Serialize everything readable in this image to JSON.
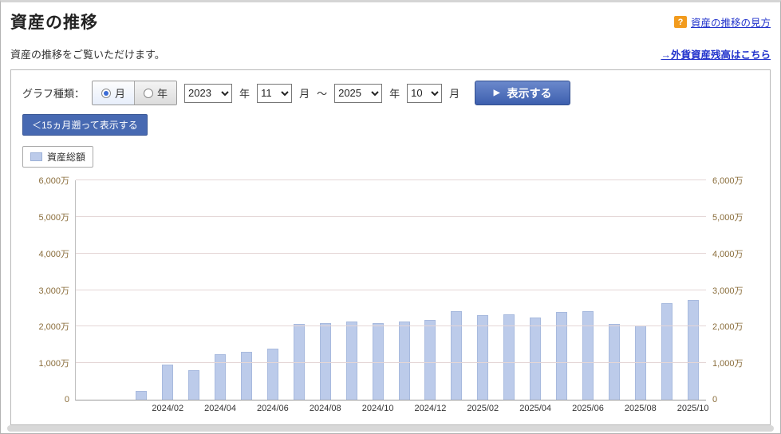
{
  "header": {
    "title": "資産の推移",
    "help_icon": "?",
    "help_link": "資産の推移の見方",
    "description": "資産の推移をご覧いただけます。",
    "foreign_assets_link": "→外貨資産残高はこちら"
  },
  "controls": {
    "graph_type_label": "グラフ種類：",
    "radio_month_label": "月",
    "radio_year_label": "年",
    "selected_graph_type": "月",
    "from_year": "2023",
    "from_month": "11",
    "to_year": "2025",
    "to_month": "10",
    "year_unit": "年",
    "month_unit": "月",
    "range_separator": "～",
    "show_button_icon": "▶",
    "show_button_label": "表示する",
    "back_button_label": "＜15ヵ月遡って表示する"
  },
  "legend": {
    "label": "資産総額",
    "color": "#bccbea"
  },
  "chart_data": {
    "type": "bar",
    "title": "資産総額",
    "unit": "万円",
    "categories": [
      "2023/11",
      "2023/12",
      "2024/01",
      "2024/02",
      "2024/03",
      "2024/04",
      "2024/05",
      "2024/06",
      "2024/07",
      "2024/08",
      "2024/09",
      "2024/10",
      "2024/11",
      "2024/12",
      "2025/01",
      "2025/02",
      "2025/03",
      "2025/04",
      "2025/05",
      "2025/06",
      "2025/07",
      "2025/08",
      "2025/09",
      "2025/10"
    ],
    "values": [
      0,
      0,
      250,
      950,
      800,
      1250,
      1300,
      1400,
      2080,
      2100,
      2130,
      2090,
      2140,
      2180,
      2430,
      2320,
      2340,
      2240,
      2390,
      2430,
      2080,
      2040,
      2650,
      2720
    ],
    "ylim": [
      0,
      6000
    ],
    "ytick_step": 1000,
    "ytick_labels": [
      "0",
      "1,000万",
      "2,000万",
      "3,000万",
      "4,000万",
      "5,000万",
      "6,000万"
    ],
    "xtick_labels": [
      "2024/02",
      "2024/04",
      "2024/06",
      "2024/08",
      "2024/10",
      "2024/12",
      "2025/02",
      "2025/04",
      "2025/06",
      "2025/08",
      "2025/10"
    ],
    "bar_color": "#bccbea",
    "grid": true,
    "legend_position": "top-left",
    "axis_label_color": "#8a6d3b"
  }
}
